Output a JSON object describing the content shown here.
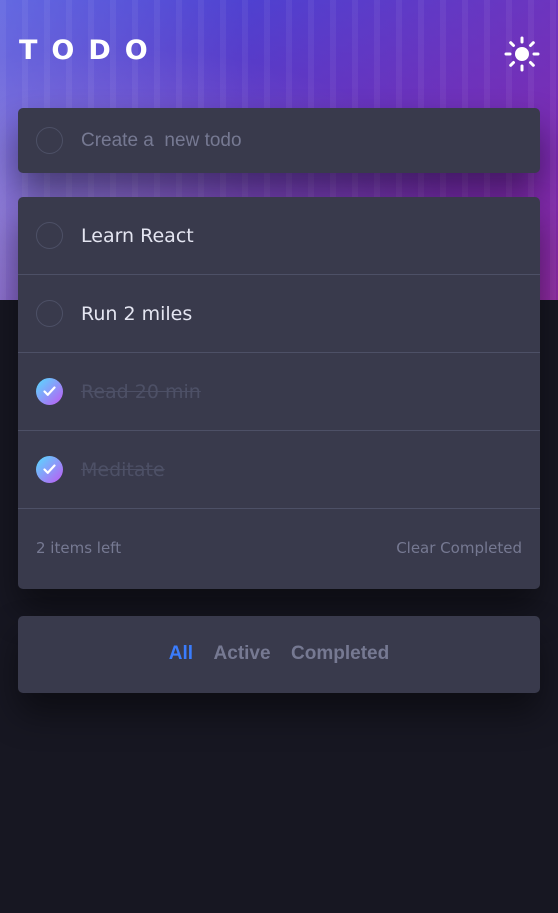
{
  "header": {
    "title": "TODO",
    "theme_toggle_icon": "sun-icon"
  },
  "create": {
    "placeholder": "Create a  new todo"
  },
  "todos": [
    {
      "text": "Learn React",
      "completed": false
    },
    {
      "text": "Run 2 miles",
      "completed": false
    },
    {
      "text": "Read 20 min",
      "completed": true
    },
    {
      "text": "Meditate",
      "completed": true
    }
  ],
  "footer": {
    "items_left": "2 items left",
    "clear_label": "Clear Completed"
  },
  "filters": {
    "all": "All",
    "active": "Active",
    "completed": "Completed",
    "selected": "All"
  },
  "colors": {
    "accent": "#3a7cfd",
    "check_gradient_start": "#55ddff",
    "check_gradient_end": "#c058f3",
    "card_bg": "#393a4c",
    "page_bg": "#171722"
  }
}
